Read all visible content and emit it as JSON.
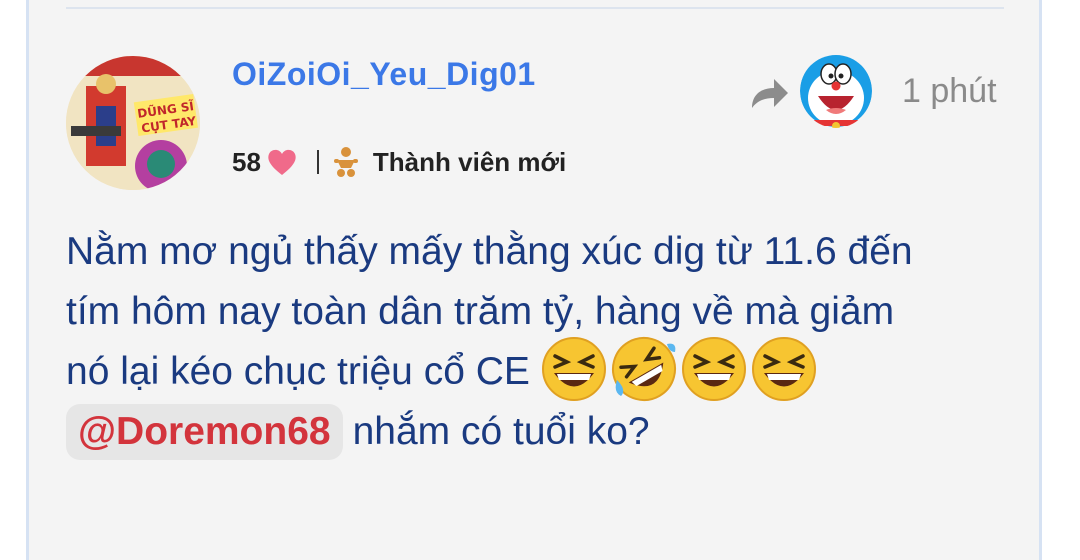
{
  "post": {
    "username": "OiZoiOi_Yeu_Dig01",
    "likes": "58",
    "rank": "Thành viên mới",
    "time": "1 phút",
    "avatar_text": {
      "top": "DŨNG SĨ",
      "bottom": "CỤT TAY"
    },
    "body_lines": [
      "Nằm mơ ngủ thấy mấy thằng xúc dig từ 11.6 đến",
      "tím hôm nay toàn dân trăm tỷ, hàng về mà giảm",
      "nó lại kéo chục triệu cổ CE"
    ],
    "emojis": [
      "grinning-squinting-face",
      "rolling-on-floor-laughing",
      "grinning-squinting-face",
      "grinning-squinting-face"
    ],
    "mention": "@Doremon68",
    "after_mention": "nhắm có tuổi ko?"
  },
  "colors": {
    "username": "#3b78e7",
    "body": "#1a3a80",
    "mention": "#d3343c",
    "heart": "#f06a8a",
    "time": "#8a8a8a"
  }
}
